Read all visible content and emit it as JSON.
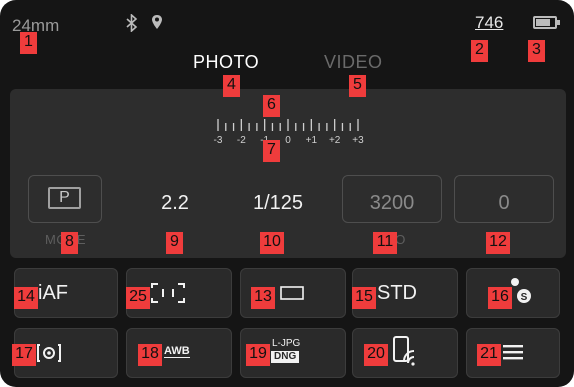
{
  "status": {
    "focal_length": "24mm",
    "shots_remaining": "746",
    "battery_level": 0.8
  },
  "tabs": {
    "photo": "PHOTO",
    "video": "VIDEO"
  },
  "exposure_scale": {
    "ticks": [
      "-3",
      "-2",
      "-1",
      "0",
      "+1",
      "+2",
      "+3"
    ]
  },
  "params": {
    "mode_value": "P",
    "mode_label": "MODE",
    "aperture": "2.2",
    "shutter": "1/125",
    "iso": "3200",
    "iso_label": "ISO",
    "ev": "0"
  },
  "tiles": {
    "af_mode": "iAF",
    "film_style": "STD",
    "wb": "AWB",
    "format_top": "L-JPG",
    "format_bottom": "DNG"
  },
  "callouts": [
    "1",
    "2",
    "3",
    "4",
    "5",
    "6",
    "7",
    "8",
    "9",
    "10",
    "11",
    "12",
    "13",
    "14",
    "15",
    "16",
    "17",
    "18",
    "19",
    "20",
    "21",
    "25"
  ],
  "colors": {
    "background": "#151515",
    "panel": "#2d2d2d",
    "tile": "#2a2a2a",
    "callout": "#ef3c3c"
  }
}
